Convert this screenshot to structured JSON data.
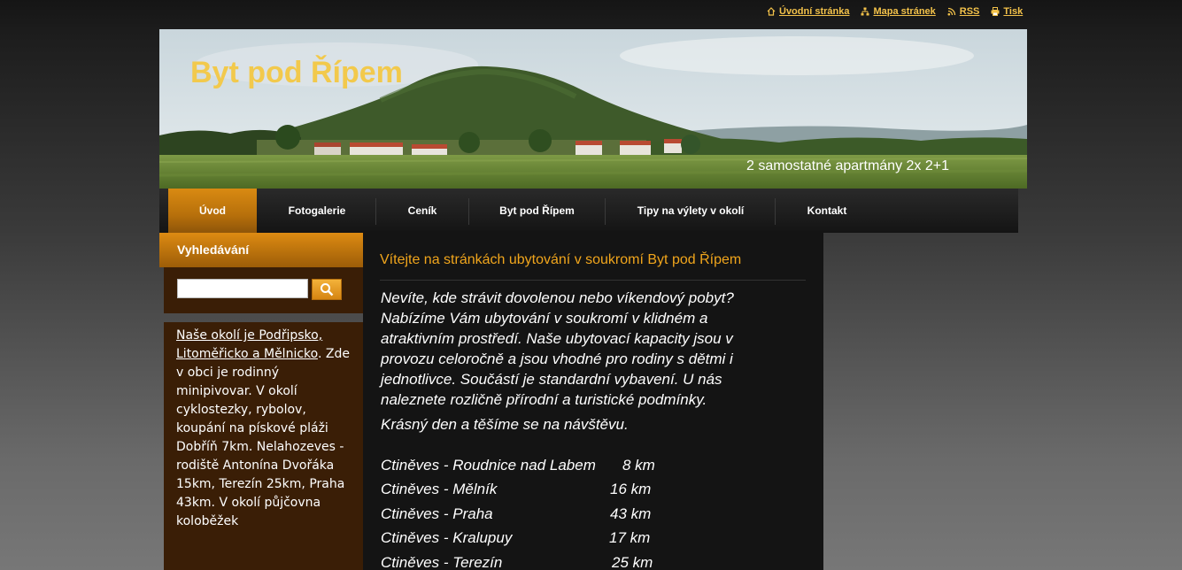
{
  "toplinks": [
    {
      "label": "Úvodní stránka",
      "icon": "home-icon"
    },
    {
      "label": "Mapa stránek",
      "icon": "sitemap-icon"
    },
    {
      "label": "RSS",
      "icon": "rss-icon"
    },
    {
      "label": "Tisk",
      "icon": "print-icon"
    }
  ],
  "header": {
    "title": "Byt pod Řípem",
    "subtitle": "2 samostatné apartmány 2x 2+1"
  },
  "nav": [
    {
      "label": "Úvod",
      "active": true
    },
    {
      "label": "Fotogalerie"
    },
    {
      "label": "Ceník"
    },
    {
      "label": "Byt pod Řípem"
    },
    {
      "label": "Tipy na výlety v okolí"
    },
    {
      "label": "Kontakt"
    }
  ],
  "sidebar": {
    "search_title": "Vyhledávání",
    "search_value": "",
    "link_text": "Naše okolí je Podřipsko, Litoměřicko a Mělnicko",
    "link_suffix": ".",
    "body": "Zde v obci je rodinný minipivovar. V okolí cyklostezky, rybolov, koupání na pískové pláži Dobříň 7km. Nelahozeves - rodiště Antonína Dvořáka 15km, Terezín 25km, Praha 43km. V okolí půjčovna koloběžek"
  },
  "content": {
    "title": "Vítejte na stránkách ubytování v soukromí Byt pod Řípem",
    "paragraph1": "Nevíte, kde strávit dovolenou nebo víkendový pobyt? Nabízíme Vám ubytování v soukromí v klidném a atraktivním prostředí. Naše ubytovací kapacity jsou v provozu celoročně a jsou vhodné pro rodiny s dětmi i jednotlivce. Součástí je standardní vybavení. U nás naleznete rozličně přírodní a turistické podmínky.",
    "paragraph2": "Krásný den a těšíme se na návštěvu.",
    "distances": [
      {
        "route": "Ctiněves - Roudnice nad Labem",
        "km": "8 km"
      },
      {
        "route": "Ctiněves - Mělník",
        "km": "16 km"
      },
      {
        "route": "Ctiněves - Praha",
        "km": "43 km"
      },
      {
        "route": "Ctiněves - Kralupuy",
        "km": "17 km"
      },
      {
        "route": "Ctiněves - Terezín",
        "km": "25 km"
      }
    ]
  },
  "colors": {
    "accent": "#f0a51c",
    "link_yellow": "#f3c24a",
    "sidebar_bg": "#3a1e06"
  }
}
